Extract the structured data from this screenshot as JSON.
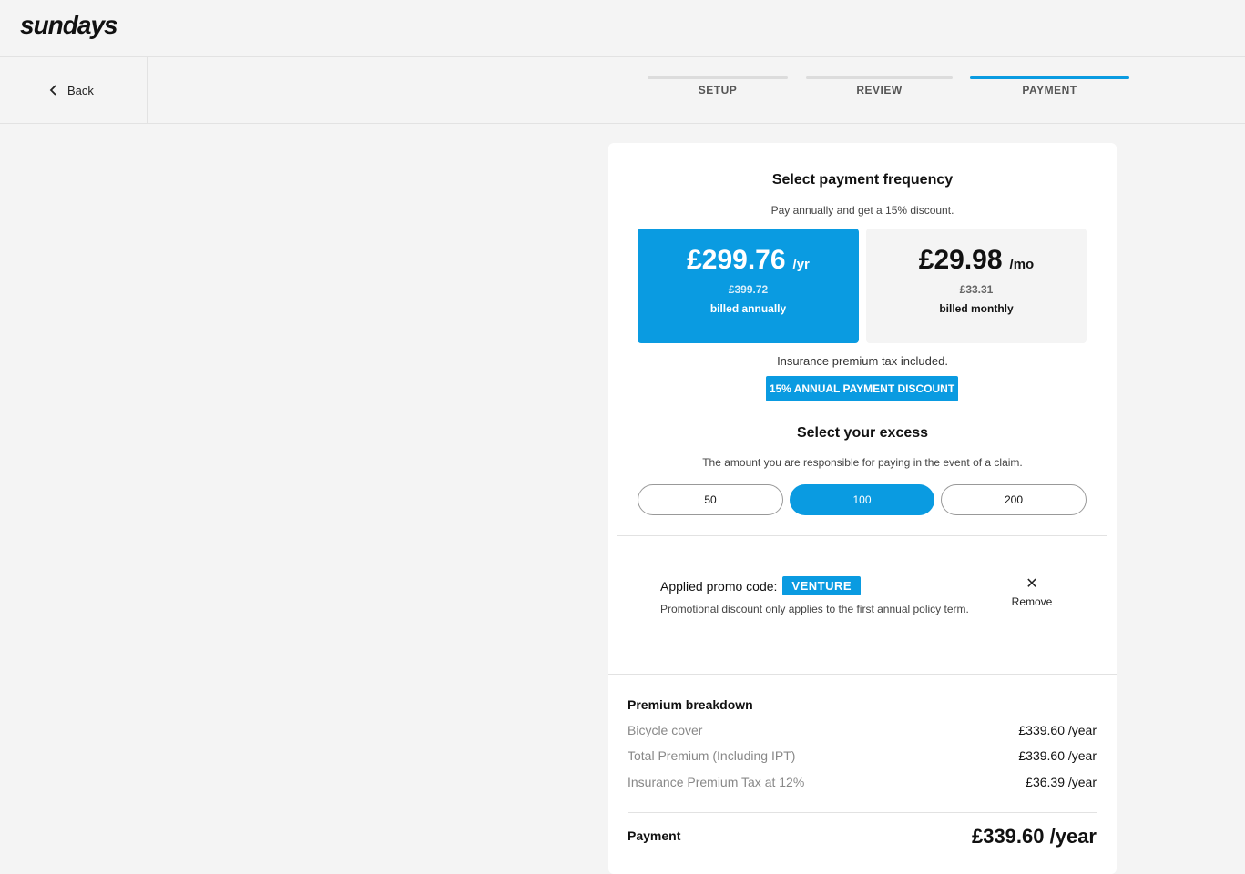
{
  "header": {
    "logo": "sundays"
  },
  "nav": {
    "back_label": "Back",
    "steps": [
      {
        "label": "SETUP",
        "active": false
      },
      {
        "label": "REVIEW",
        "active": false
      },
      {
        "label": "PAYMENT",
        "active": true
      }
    ]
  },
  "frequency": {
    "title": "Select payment frequency",
    "subtitle": "Pay annually and get a 15% discount.",
    "annual": {
      "price": "£299.76",
      "period": "/yr",
      "old_price": "£399.72",
      "billed": "billed annually",
      "selected": true
    },
    "monthly": {
      "price": "£29.98",
      "period": "/mo",
      "old_price": "£33.31",
      "billed": "billed monthly",
      "selected": false
    },
    "tax_note": "Insurance premium tax included.",
    "discount_badge": "15% ANNUAL PAYMENT DISCOUNT"
  },
  "excess": {
    "title": "Select your excess",
    "subtitle": "The amount you are responsible for paying in the event of a claim.",
    "options": [
      "50",
      "100",
      "200"
    ],
    "selected": "100"
  },
  "promo": {
    "label": "Applied promo code:",
    "code": "VENTURE",
    "note": "Promotional discount only applies to the first annual policy term.",
    "remove_label": "Remove",
    "remove_icon": "close-icon"
  },
  "breakdown": {
    "title": "Premium breakdown",
    "rows": [
      {
        "label": "Bicycle cover",
        "value": "£339.60 /year"
      },
      {
        "label": "Total Premium (Including IPT)",
        "value": "£339.60 /year"
      },
      {
        "label": "Insurance Premium Tax at 12%",
        "value": "£36.39 /year"
      }
    ],
    "payment_label": "Payment",
    "payment_value": "£339.60 /year"
  },
  "colors": {
    "accent": "#0a9be1",
    "background": "#f4f4f4",
    "card": "#ffffff"
  }
}
